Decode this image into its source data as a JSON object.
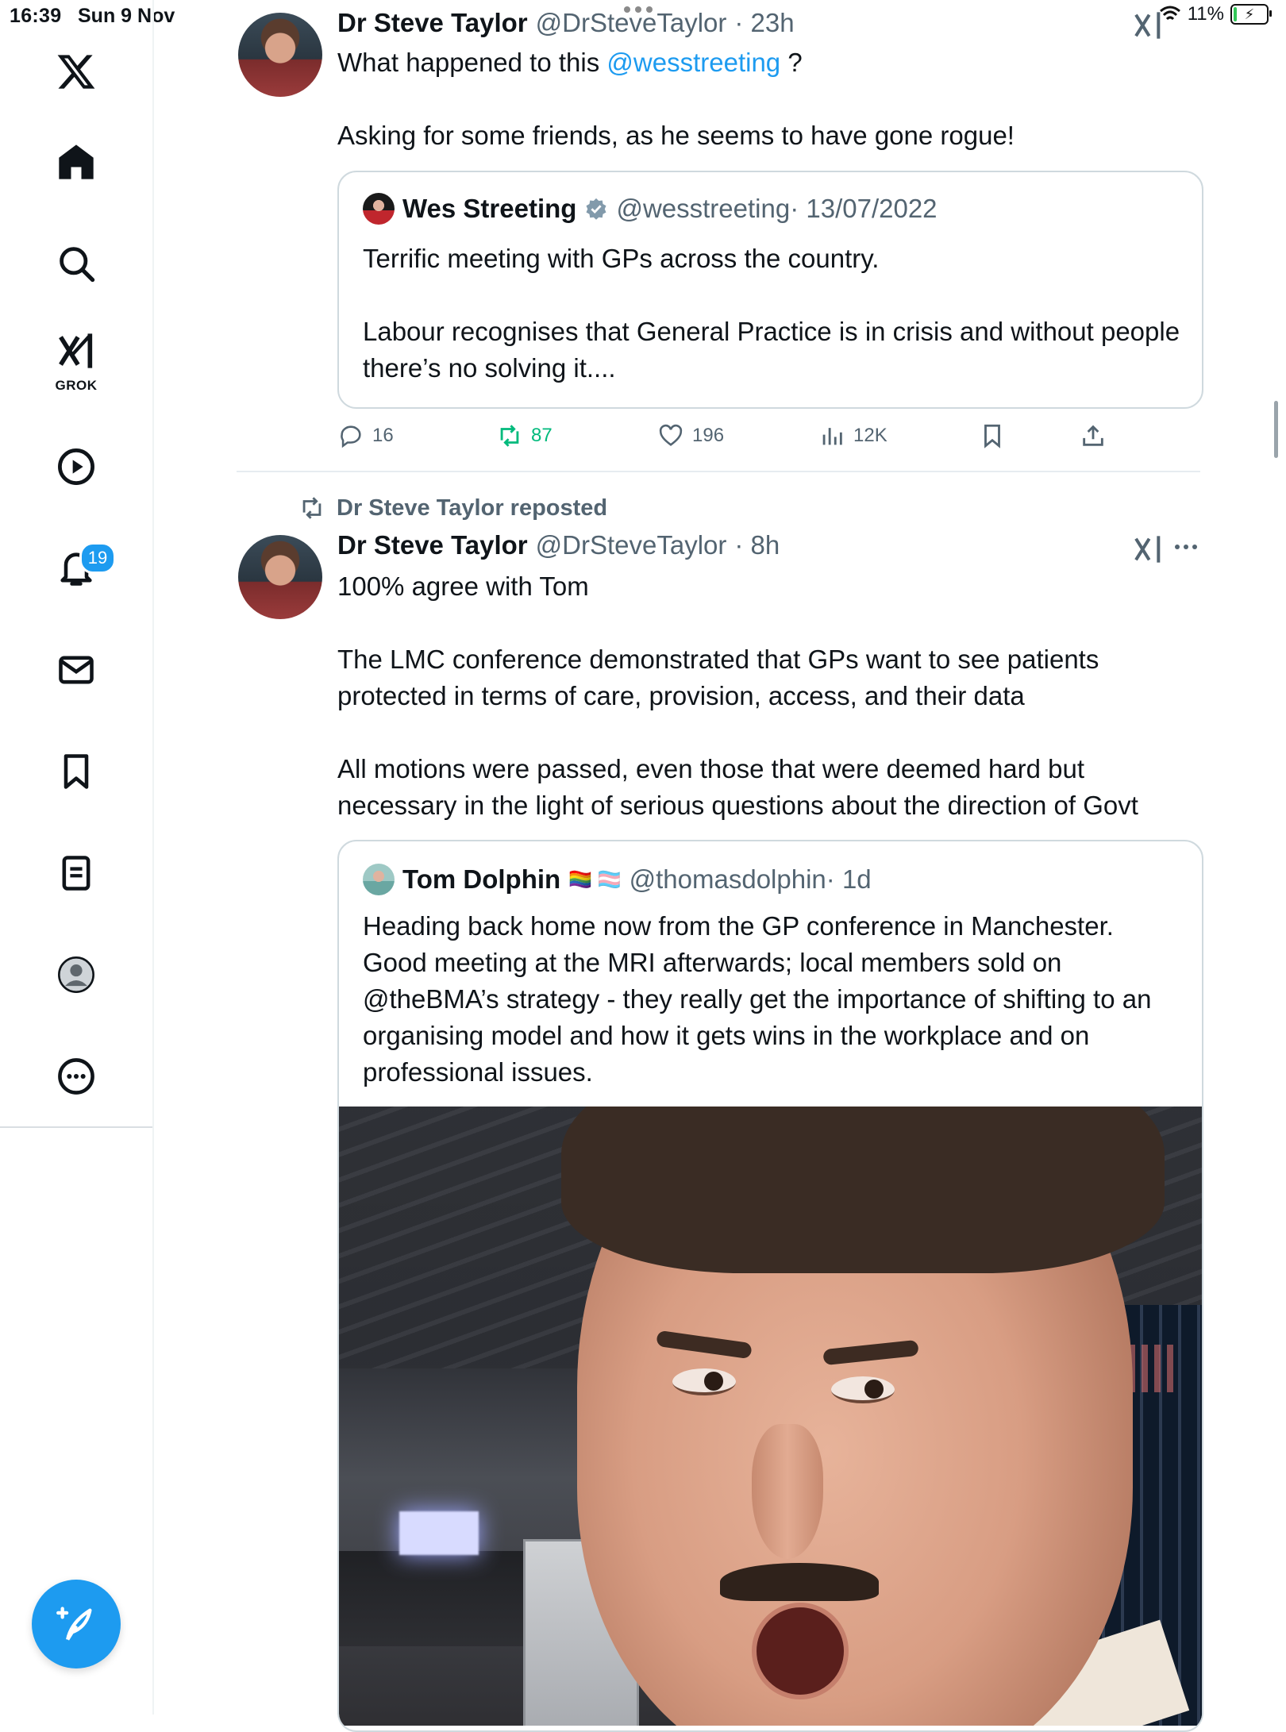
{
  "status_bar": {
    "time": "16:39",
    "date": "Sun 9 Nov",
    "battery_percent": "11%",
    "battery_level": 0.11
  },
  "sidebar": {
    "items": [
      {
        "icon": "x-logo-icon"
      },
      {
        "icon": "home-icon"
      },
      {
        "icon": "search-icon"
      },
      {
        "icon": "grok-icon",
        "label": "GROK"
      },
      {
        "icon": "play-icon"
      },
      {
        "icon": "bell-icon",
        "badge": "19"
      },
      {
        "icon": "mail-icon"
      },
      {
        "icon": "bookmark-icon"
      },
      {
        "icon": "list-icon"
      },
      {
        "icon": "profile-icon"
      },
      {
        "icon": "more-icon"
      }
    ],
    "compose_icon": "compose-icon"
  },
  "tweet1": {
    "name": "Dr Steve Taylor",
    "handle": "@DrSteveTaylor",
    "time": "· 23h",
    "text_line1_a": "What happened to this ",
    "text_line1_mention": "@wesstreeting",
    "text_line1_b": " ?",
    "text_line2": "Asking for some friends, as he seems to have gone rogue!",
    "quote": {
      "name": "Wes Streeting",
      "handle": "@wesstreeting",
      "time": "· 13/07/2022",
      "text": "Terrific meeting with GPs across the country.\n\nLabour recognises that General Practice is in crisis and without people there’s no solving it...."
    },
    "actions": {
      "replies": "16",
      "reposts": "87",
      "likes": "196",
      "views": "12K"
    }
  },
  "tweet2": {
    "repost_label": "Dr Steve Taylor reposted",
    "name": "Dr Steve Taylor",
    "handle": "@DrSteveTaylor",
    "time": "· 8h",
    "text": "100% agree with Tom\n\nThe LMC conference demonstrated that GPs want to see patients protected in terms of care, provision, access, and their data\n\nAll motions were passed, even those that were deemed hard but necessary in the light of serious questions about the direction of Govt",
    "quote": {
      "name": "Tom Dolphin",
      "flags": "🏳️‍🌈 🏳️‍⚧️",
      "handle": "@thomasdolphin",
      "time": "· 1d",
      "text": "Heading back home now from the GP conference in Manchester. Good meeting at the MRI afterwards; local members sold on @theBMA’s strategy - they really get the importance of shifting to an organising model and how it gets wins in the workplace and on professional issues."
    }
  },
  "colors": {
    "accent": "#1d9bf0",
    "repost_green": "#00ba7c",
    "secondary_text": "#536471",
    "border": "#cfd9de"
  }
}
